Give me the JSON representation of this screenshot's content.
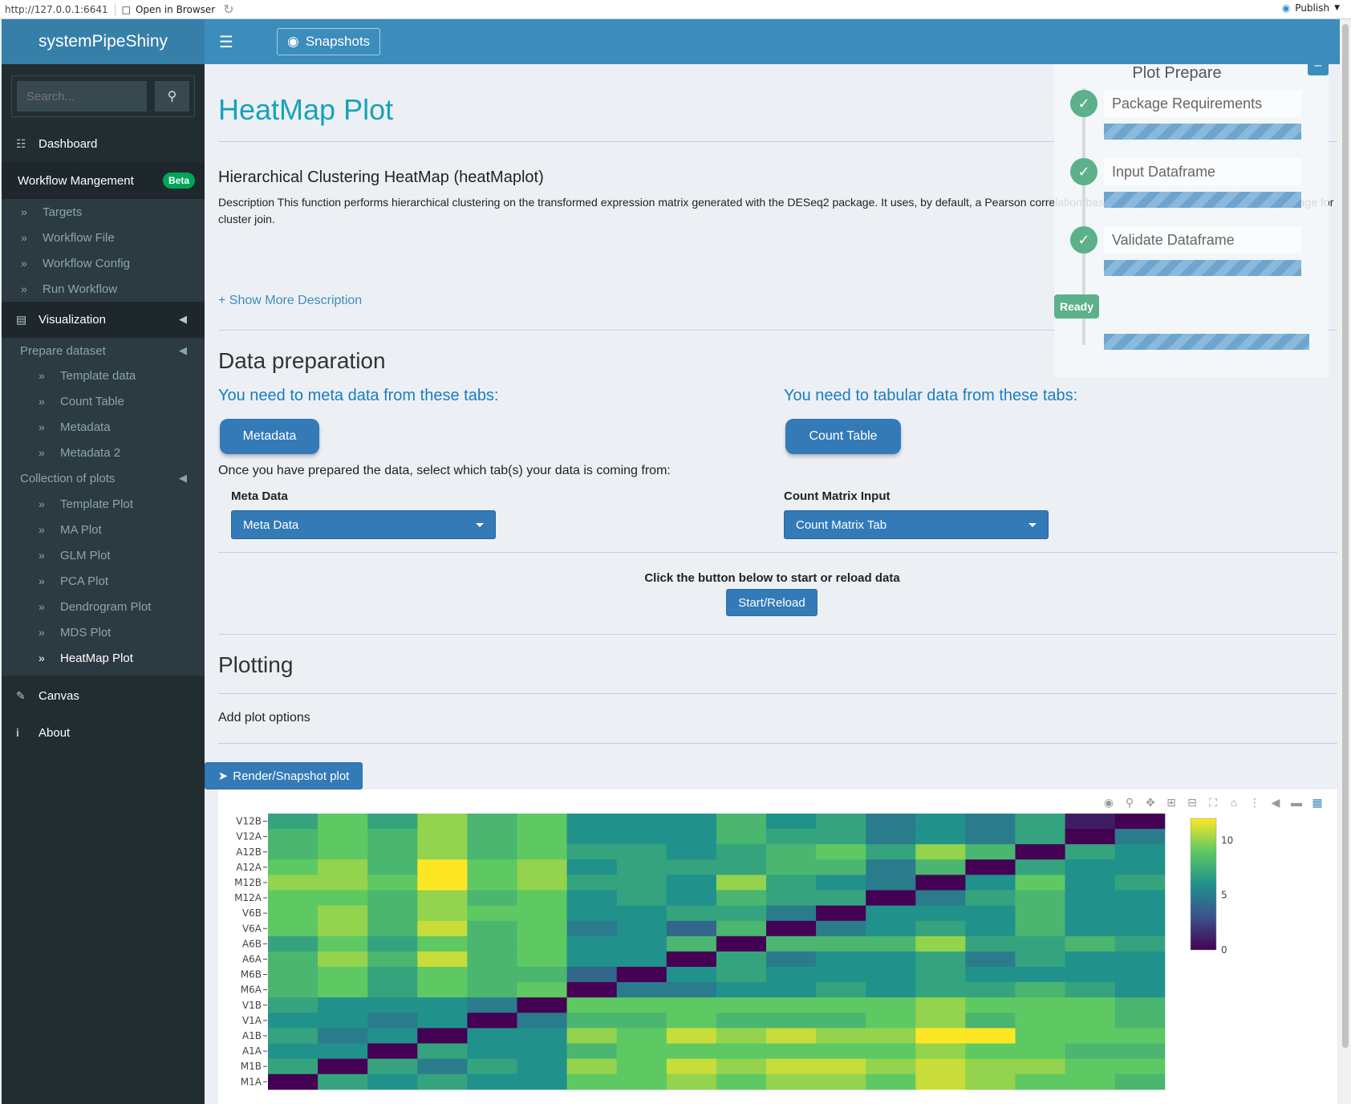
{
  "browser": {
    "url": "http://127.0.0.1:6641",
    "open_label": "Open in Browser",
    "publish_label": "Publish"
  },
  "sidebar": {
    "logo": "systemPipeShiny",
    "search_placeholder": "Search...",
    "dashboard": "Dashboard",
    "workflow": "Workflow Mangement",
    "beta": "Beta",
    "workflow_items": [
      "Targets",
      "Workflow File",
      "Workflow Config",
      "Run Workflow"
    ],
    "visualization": "Visualization",
    "prepare_dataset": "Prepare dataset",
    "prepare_items": [
      "Template data",
      "Count Table",
      "Metadata",
      "Metadata 2"
    ],
    "collection": "Collection of plots",
    "plot_items": [
      "Template Plot",
      "MA Plot",
      "GLM Plot",
      "PCA Plot",
      "Dendrogram Plot",
      "MDS Plot",
      "HeatMap Plot"
    ],
    "canvas": "Canvas",
    "about": "About"
  },
  "header": {
    "snapshots": "Snapshots"
  },
  "main": {
    "title": "HeatMap Plot",
    "fn_title": "Hierarchical Clustering HeatMap (heatMaplot)",
    "description": "Description This function performs hierarchical clustering on the transformed expression matrix generated with the DESeq2 package. It uses, by default, a Pearson correlation-based distance measure and complete linkage for cluster join.",
    "show_more": "+ Show More Description",
    "data_prep": "Data preparation",
    "need_meta": "You need to meta data from these tabs:",
    "need_tab": "You need to tabular data from these tabs:",
    "meta_btn": "Metadata",
    "count_btn": "Count Table",
    "once": "Once you have prepared the data, select which tab(s) your data is coming from:",
    "meta_label": "Meta Data",
    "meta_value": "Meta Data",
    "count_label": "Count Matrix Input",
    "count_value": "Count Matrix Tab",
    "click_label": "Click the button below to start or reload data",
    "start": "Start/Reload",
    "plotting": "Plotting",
    "add_opts": "Add plot options",
    "render": "Render/Snapshot plot"
  },
  "prepare": {
    "title": "Plot Prepare",
    "steps": [
      "Package Requirements",
      "Input Dataframe",
      "Validate Dataframe"
    ],
    "ready": "Ready"
  },
  "chart_data": {
    "type": "heatmap",
    "y_labels": [
      "V12B",
      "V12A",
      "A12B",
      "A12A",
      "M12B",
      "M12A",
      "V6B",
      "V6A",
      "A6B",
      "A6A",
      "M6B",
      "M6A",
      "V1B",
      "V1A",
      "A1B",
      "A1A",
      "M1B",
      "M1A"
    ],
    "colorbar_ticks": [
      0,
      5,
      10
    ],
    "colorscale": "viridis",
    "values": [
      [
        7,
        9,
        7,
        10,
        8,
        9,
        6,
        6,
        6,
        8,
        6,
        7,
        5,
        6,
        5,
        7,
        1,
        0
      ],
      [
        8,
        9,
        8,
        10,
        8,
        9,
        6,
        6,
        6,
        8,
        7,
        7,
        5,
        6,
        5,
        7,
        0,
        5
      ],
      [
        8,
        9,
        8,
        10,
        8,
        9,
        7,
        7,
        6,
        7,
        8,
        9,
        7,
        10,
        8,
        0,
        7,
        6
      ],
      [
        9,
        10,
        8,
        12,
        9,
        10,
        6,
        7,
        7,
        7,
        8,
        8,
        5,
        8,
        0,
        7,
        6,
        6
      ],
      [
        10,
        10,
        9,
        12,
        9,
        10,
        7,
        7,
        6,
        10,
        7,
        6,
        5,
        0,
        6,
        9,
        6,
        7
      ],
      [
        9,
        9,
        8,
        10,
        8,
        9,
        6,
        7,
        6,
        8,
        7,
        7,
        0,
        5,
        7,
        8,
        6,
        6
      ],
      [
        9,
        10,
        8,
        10,
        9,
        9,
        6,
        6,
        7,
        7,
        5,
        0,
        6,
        6,
        6,
        8,
        6,
        6
      ],
      [
        9,
        10,
        8,
        11,
        8,
        9,
        5,
        6,
        4,
        8,
        0,
        5,
        6,
        7,
        6,
        8,
        6,
        6
      ],
      [
        7,
        9,
        7,
        9,
        8,
        9,
        6,
        6,
        8,
        0,
        8,
        8,
        8,
        10,
        7,
        7,
        8,
        7
      ],
      [
        8,
        10,
        8,
        11,
        8,
        9,
        6,
        6,
        0,
        7,
        5,
        6,
        6,
        7,
        5,
        7,
        6,
        6
      ],
      [
        8,
        9,
        7,
        9,
        8,
        8,
        4,
        0,
        6,
        7,
        6,
        6,
        6,
        7,
        6,
        6,
        6,
        6
      ],
      [
        8,
        9,
        7,
        9,
        8,
        9,
        0,
        5,
        5,
        6,
        6,
        7,
        6,
        7,
        7,
        8,
        7,
        6
      ],
      [
        7,
        6,
        6,
        6,
        5,
        0,
        9,
        9,
        9,
        9,
        9,
        9,
        9,
        10,
        9,
        9,
        9,
        8
      ],
      [
        6,
        6,
        5,
        6,
        0,
        5,
        8,
        8,
        9,
        8,
        8,
        8,
        9,
        10,
        8,
        9,
        9,
        8
      ],
      [
        7,
        5,
        6,
        0,
        6,
        6,
        10,
        9,
        11,
        10,
        11,
        10,
        10,
        12,
        12,
        9,
        9,
        9
      ],
      [
        6,
        6,
        0,
        7,
        6,
        6,
        8,
        9,
        9,
        9,
        9,
        9,
        9,
        10,
        9,
        9,
        8,
        8
      ],
      [
        7,
        0,
        7,
        5,
        7,
        6,
        10,
        9,
        11,
        10,
        11,
        11,
        10,
        11,
        10,
        10,
        9,
        9
      ],
      [
        0,
        7,
        6,
        7,
        6,
        6,
        9,
        9,
        10,
        9,
        10,
        10,
        9,
        11,
        10,
        9,
        9,
        8
      ]
    ]
  }
}
